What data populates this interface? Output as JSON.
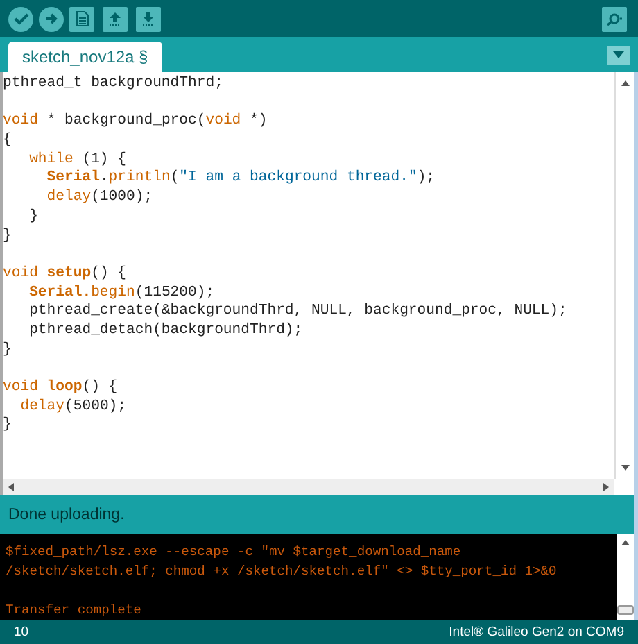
{
  "toolbar": {
    "buttons": [
      {
        "kind": "verify"
      },
      {
        "kind": "upload"
      },
      {
        "kind": "new"
      },
      {
        "kind": "open"
      },
      {
        "kind": "save"
      }
    ],
    "serial_monitor": {
      "kind": "search"
    }
  },
  "tabs": [
    {
      "label": "sketch_nov12a §",
      "selected": true
    }
  ],
  "editor": {
    "blocks": [
      [
        [
          {
            "kind": "plain",
            "text": "pthread_t backgroundThrd;"
          }
        ]
      ],
      [
        [
          {
            "kind": "keyword",
            "text": "void"
          },
          {
            "kind": "plain",
            "text": " * background_proc("
          },
          {
            "kind": "keyword",
            "text": "void"
          },
          {
            "kind": "plain",
            "text": " *)"
          }
        ],
        [
          {
            "kind": "plain",
            "text": "{"
          }
        ],
        [
          {
            "kind": "keyword",
            "text": "   while"
          },
          {
            "kind": "plain",
            "text": " (1) {"
          }
        ],
        [
          {
            "kind": "bold",
            "text": "     Serial"
          },
          {
            "kind": "plain",
            "text": "."
          },
          {
            "kind": "keyword",
            "text": "println"
          },
          {
            "kind": "plain",
            "text": "("
          },
          {
            "kind": "string",
            "text": "\"I am a background thread.\""
          },
          {
            "kind": "plain",
            "text": ");"
          }
        ],
        [
          {
            "kind": "keyword",
            "text": "     delay"
          },
          {
            "kind": "plain",
            "text": "(1000);"
          }
        ],
        [
          {
            "kind": "plain",
            "text": "   }"
          }
        ],
        [
          {
            "kind": "plain",
            "text": "}"
          }
        ]
      ],
      [
        [
          {
            "kind": "keyword",
            "text": "void"
          },
          {
            "kind": "bold",
            "text": " setup"
          },
          {
            "kind": "plain",
            "text": "() {"
          }
        ],
        [
          {
            "kind": "bold",
            "text": "   Serial."
          },
          {
            "kind": "keyword",
            "text": "begin"
          },
          {
            "kind": "plain",
            "text": "(115200);"
          }
        ],
        [
          {
            "kind": "plain",
            "text": "   pthread_create(&backgroundThrd, NULL, background_proc, NULL);"
          }
        ],
        [
          {
            "kind": "plain",
            "text": "   pthread_detach(backgroundThrd);"
          }
        ],
        [
          {
            "kind": "plain",
            "text": "}"
          }
        ]
      ],
      [
        [
          {
            "kind": "keyword",
            "text": "void"
          },
          {
            "kind": "bold",
            "text": " loop"
          },
          {
            "kind": "plain",
            "text": "() {"
          }
        ],
        [
          {
            "kind": "keyword",
            "text": "  delay"
          },
          {
            "kind": "plain",
            "text": "(5000);"
          }
        ],
        [
          {
            "kind": "plain",
            "text": "}"
          }
        ]
      ]
    ]
  },
  "status": "Done uploading.",
  "console": {
    "blocks": [
      [
        "$fixed_path/lsz.exe --escape -c \"mv $target_download_name",
        "/sketch/sketch.elf; chmod +x /sketch/sketch.elf\" <> $tty_port_id 1>&0"
      ],
      [
        "Transfer complete"
      ]
    ]
  },
  "footer": {
    "line": "10",
    "board": "Intel® Galileo Gen2 on COM9"
  }
}
